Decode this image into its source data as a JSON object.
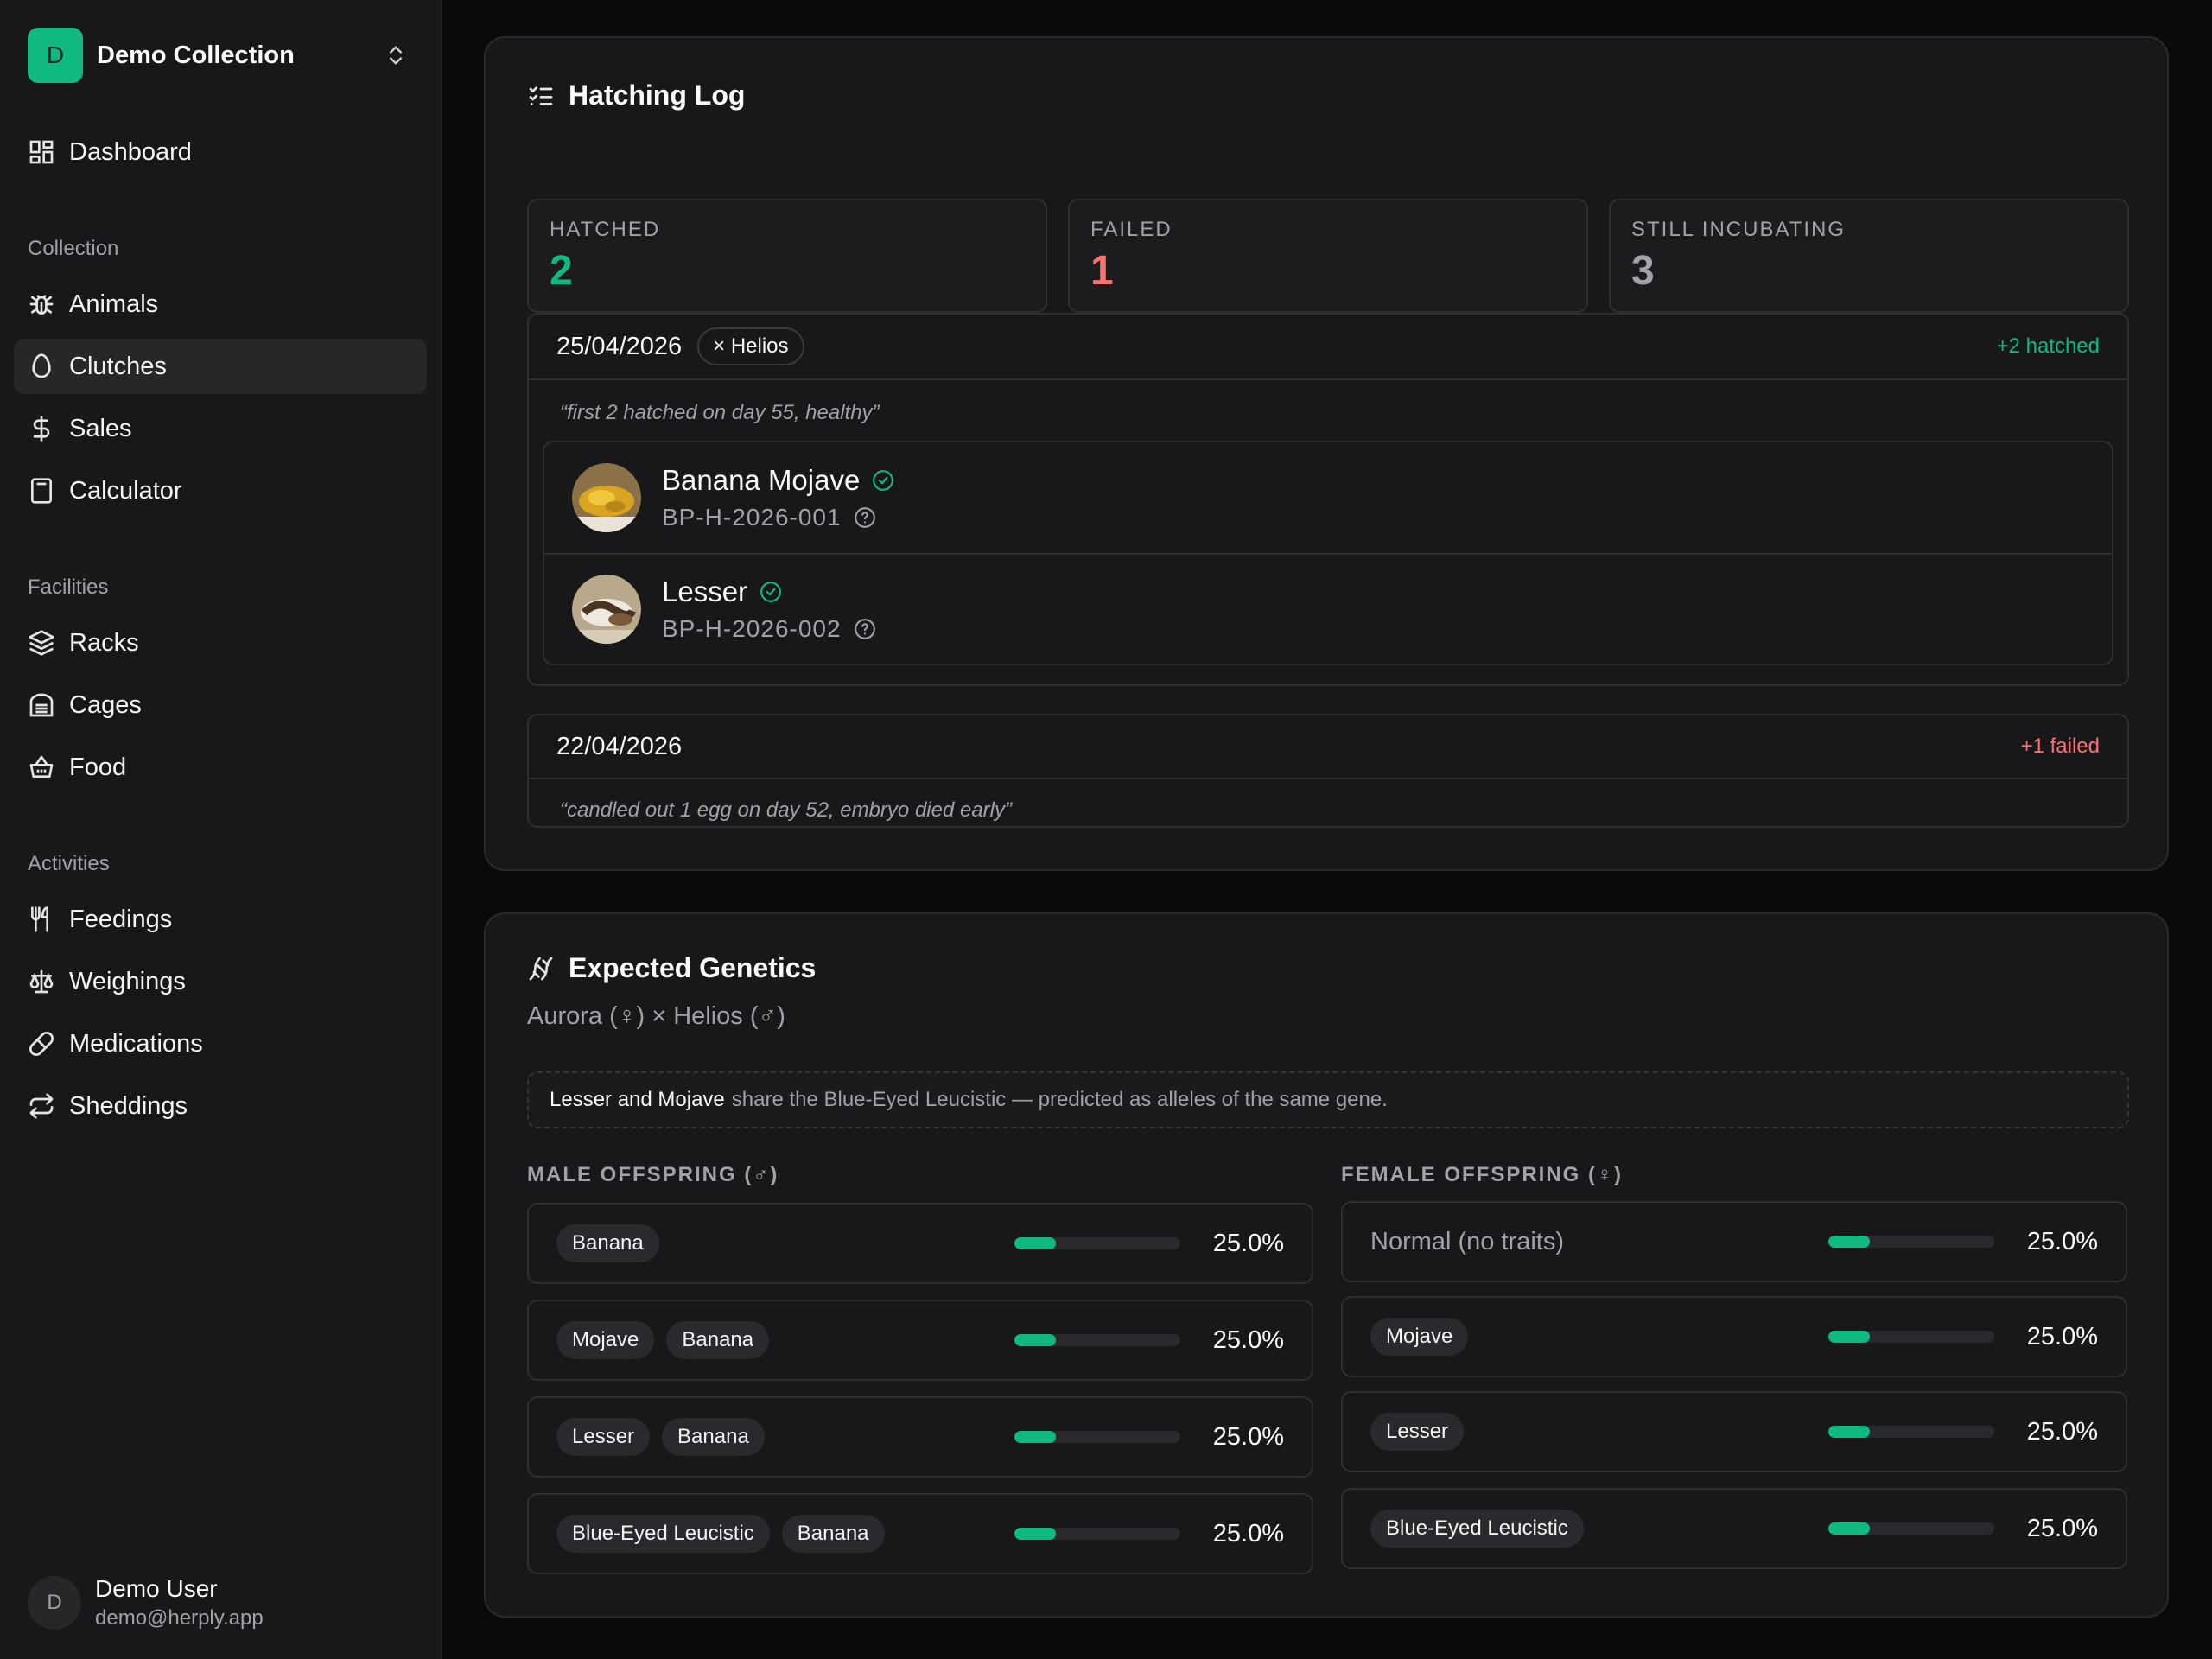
{
  "workspace": {
    "initial": "D",
    "name": "Demo Collection"
  },
  "nav": {
    "dashboard": "Dashboard",
    "sections": {
      "collection": "Collection",
      "facilities": "Facilities",
      "activities": "Activities"
    },
    "animals": "Animals",
    "clutches": "Clutches",
    "sales": "Sales",
    "calculator": "Calculator",
    "racks": "Racks",
    "cages": "Cages",
    "food": "Food",
    "feedings": "Feedings",
    "weighings": "Weighings",
    "medications": "Medications",
    "sheddings": "Sheddings",
    "active_item": "Clutches"
  },
  "user": {
    "initial": "D",
    "name": "Demo User",
    "email": "demo@herply.app"
  },
  "hatching_log": {
    "title": "Hatching Log",
    "stats": [
      {
        "label": "HATCHED",
        "value": "2",
        "color": "#10b981"
      },
      {
        "label": "FAILED",
        "value": "1",
        "color": "#f87171"
      },
      {
        "label": "STILL INCUBATING",
        "value": "3",
        "color": "#a1a1aa"
      }
    ],
    "entries": [
      {
        "date": "25/04/2026",
        "sire_pill": "× Helios",
        "result": "+2 hatched",
        "result_color": "#10b981",
        "note": "“first 2 hatched on day 55, healthy”",
        "hatchlings": [
          {
            "name": "Banana Mojave",
            "id": "BP-H-2026-001"
          },
          {
            "name": "Lesser",
            "id": "BP-H-2026-002"
          }
        ]
      },
      {
        "date": "22/04/2026",
        "result": "+1 failed",
        "result_color": "#f87171",
        "note": "“candled out 1 egg on day 52, embryo died early”"
      }
    ]
  },
  "genetics": {
    "title": "Expected Genetics",
    "pairing": "Aurora (♀) × Helios (♂)",
    "notice_bold": "Lesser and Mojave",
    "notice_text": "share the Blue-Eyed Leucistic — predicted as alleles of the same gene.",
    "male_label": "MALE OFFSPRING (♂)",
    "female_label": "FEMALE OFFSPRING (♀)",
    "male": [
      {
        "traits": [
          "Banana"
        ],
        "percent": "25.0%",
        "fraction": 0.25
      },
      {
        "traits": [
          "Mojave",
          "Banana"
        ],
        "percent": "25.0%",
        "fraction": 0.25
      },
      {
        "traits": [
          "Lesser",
          "Banana"
        ],
        "percent": "25.0%",
        "fraction": 0.25
      },
      {
        "traits": [
          "Blue-Eyed Leucistic",
          "Banana"
        ],
        "percent": "25.0%",
        "fraction": 0.25
      }
    ],
    "female": [
      {
        "normal_text": "Normal (no traits)",
        "percent": "25.0%",
        "fraction": 0.25
      },
      {
        "traits": [
          "Mojave"
        ],
        "percent": "25.0%",
        "fraction": 0.25
      },
      {
        "traits": [
          "Lesser"
        ],
        "percent": "25.0%",
        "fraction": 0.25
      },
      {
        "traits": [
          "Blue-Eyed Leucistic"
        ],
        "percent": "25.0%",
        "fraction": 0.25
      }
    ]
  }
}
